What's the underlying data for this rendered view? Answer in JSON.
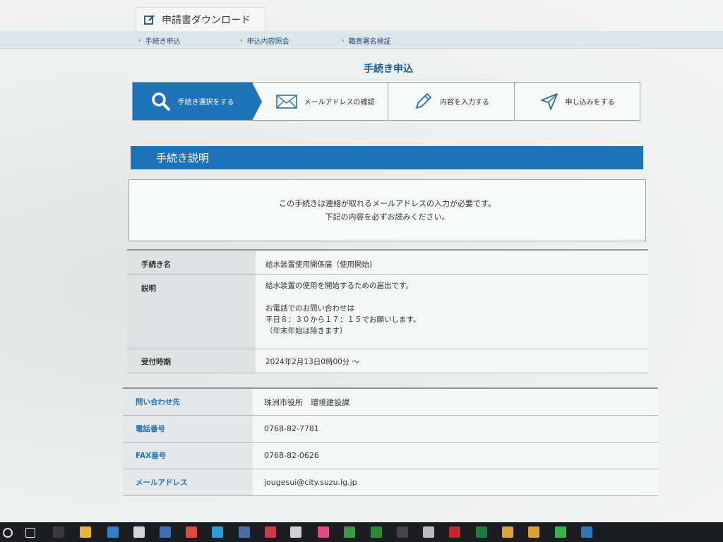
{
  "download_tab": {
    "label": "申請書ダウンロード",
    "icon": "edit-icon"
  },
  "subnav": [
    {
      "label": "手続き申込"
    },
    {
      "label": "申込内容照会"
    },
    {
      "label": "職責署名検証"
    }
  ],
  "heading": "手続き申込",
  "steps": [
    {
      "label": "手続き選択をする",
      "icon": "search-icon",
      "active": true
    },
    {
      "label": "メールアドレスの確認",
      "icon": "mail-icon",
      "active": false
    },
    {
      "label": "内容を入力する",
      "icon": "pencil-icon",
      "active": false
    },
    {
      "label": "申し込みをする",
      "icon": "send-icon",
      "active": false
    }
  ],
  "section_title": "手続き説明",
  "notice": {
    "line1": "この手続きは連絡が取れるメールアドレスの入力が必要です。",
    "line2": "下記の内容を必ずお読みください。"
  },
  "info": {
    "name_label": "手続き名",
    "name_value": "給水装置使用開係届（使用開始)",
    "desc_label": "説明",
    "desc_lines": [
      "給水装置の使用を開始するための届出です。",
      "",
      "お電話でのお問い合わせは",
      "平日８：３０から１７：１５でお願いします。",
      "（年末年始は除きます）"
    ],
    "period_label": "受付時期",
    "period_value": "2024年2月13日0時00分 ～"
  },
  "contact": {
    "inquiry_label": "問い合わせ先",
    "inquiry_value": "珠洲市役所　環境建設課",
    "phone_label": "電話番号",
    "phone_value": "0768-82-7781",
    "fax_label": "FAX番号",
    "fax_value": "0768-82-0626",
    "email_label": "メールアドレス",
    "email_value": "jougesui@city.suzu.lg.jp"
  },
  "colors": {
    "accent": "#1e73b8",
    "header_row": "#dfe2e2"
  },
  "taskbar": [
    {
      "name": "search-icon",
      "color": "#1c1d20"
    },
    {
      "name": "task-view-icon",
      "color": "#1c1d20"
    },
    {
      "name": "app-icon-1",
      "color": "#3a3a3a"
    },
    {
      "name": "explorer-icon",
      "color": "#e8b43a"
    },
    {
      "name": "app-icon-2",
      "color": "#2d7fc9"
    },
    {
      "name": "app-icon-3",
      "color": "#d0d6dc"
    },
    {
      "name": "app-icon-4",
      "color": "#3b6fb6"
    },
    {
      "name": "acrobat-icon",
      "color": "#e04a3a"
    },
    {
      "name": "app-icon-5",
      "color": "#2a9fd6"
    },
    {
      "name": "app-icon-6",
      "color": "#4a6fa6"
    },
    {
      "name": "app-icon-7",
      "color": "#c93a4a"
    },
    {
      "name": "app-icon-8",
      "color": "#cfcfcf"
    },
    {
      "name": "app-icon-9",
      "color": "#e04a7a"
    },
    {
      "name": "app-icon-10",
      "color": "#3a9a4a"
    },
    {
      "name": "app-icon-11",
      "color": "#2a8a3a"
    },
    {
      "name": "app-icon-12",
      "color": "#444444"
    },
    {
      "name": "app-icon-13",
      "color": "#bdbdbd"
    },
    {
      "name": "access-icon",
      "color": "#c0292b"
    },
    {
      "name": "excel-icon",
      "color": "#1f7a3e"
    },
    {
      "name": "app-icon-14",
      "color": "#d9a43a"
    },
    {
      "name": "chrome-icon",
      "color": "#e0a030"
    },
    {
      "name": "line-icon",
      "color": "#3ab44a"
    },
    {
      "name": "app-icon-15",
      "color": "#2a7ab6"
    }
  ]
}
